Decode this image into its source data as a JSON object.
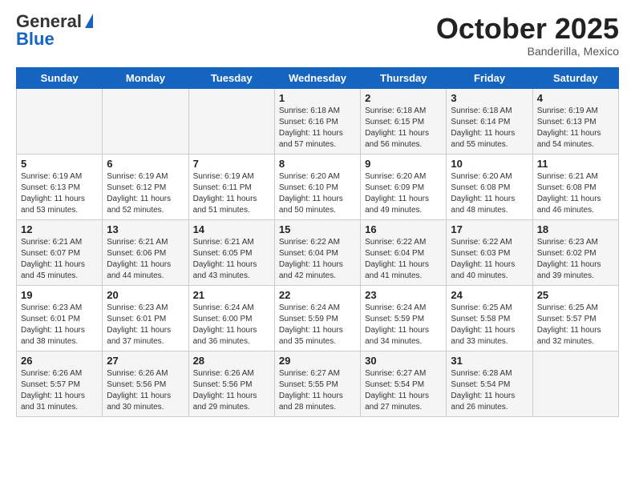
{
  "header": {
    "logo_general": "General",
    "logo_blue": "Blue",
    "month_title": "October 2025",
    "subtitle": "Banderilla, Mexico"
  },
  "days_of_week": [
    "Sunday",
    "Monday",
    "Tuesday",
    "Wednesday",
    "Thursday",
    "Friday",
    "Saturday"
  ],
  "weeks": [
    [
      null,
      null,
      null,
      {
        "day": "1",
        "sunrise": "Sunrise: 6:18 AM",
        "sunset": "Sunset: 6:16 PM",
        "daylight": "Daylight: 11 hours and 57 minutes."
      },
      {
        "day": "2",
        "sunrise": "Sunrise: 6:18 AM",
        "sunset": "Sunset: 6:15 PM",
        "daylight": "Daylight: 11 hours and 56 minutes."
      },
      {
        "day": "3",
        "sunrise": "Sunrise: 6:18 AM",
        "sunset": "Sunset: 6:14 PM",
        "daylight": "Daylight: 11 hours and 55 minutes."
      },
      {
        "day": "4",
        "sunrise": "Sunrise: 6:19 AM",
        "sunset": "Sunset: 6:13 PM",
        "daylight": "Daylight: 11 hours and 54 minutes."
      }
    ],
    [
      {
        "day": "5",
        "sunrise": "Sunrise: 6:19 AM",
        "sunset": "Sunset: 6:13 PM",
        "daylight": "Daylight: 11 hours and 53 minutes."
      },
      {
        "day": "6",
        "sunrise": "Sunrise: 6:19 AM",
        "sunset": "Sunset: 6:12 PM",
        "daylight": "Daylight: 11 hours and 52 minutes."
      },
      {
        "day": "7",
        "sunrise": "Sunrise: 6:19 AM",
        "sunset": "Sunset: 6:11 PM",
        "daylight": "Daylight: 11 hours and 51 minutes."
      },
      {
        "day": "8",
        "sunrise": "Sunrise: 6:20 AM",
        "sunset": "Sunset: 6:10 PM",
        "daylight": "Daylight: 11 hours and 50 minutes."
      },
      {
        "day": "9",
        "sunrise": "Sunrise: 6:20 AM",
        "sunset": "Sunset: 6:09 PM",
        "daylight": "Daylight: 11 hours and 49 minutes."
      },
      {
        "day": "10",
        "sunrise": "Sunrise: 6:20 AM",
        "sunset": "Sunset: 6:08 PM",
        "daylight": "Daylight: 11 hours and 48 minutes."
      },
      {
        "day": "11",
        "sunrise": "Sunrise: 6:21 AM",
        "sunset": "Sunset: 6:08 PM",
        "daylight": "Daylight: 11 hours and 46 minutes."
      }
    ],
    [
      {
        "day": "12",
        "sunrise": "Sunrise: 6:21 AM",
        "sunset": "Sunset: 6:07 PM",
        "daylight": "Daylight: 11 hours and 45 minutes."
      },
      {
        "day": "13",
        "sunrise": "Sunrise: 6:21 AM",
        "sunset": "Sunset: 6:06 PM",
        "daylight": "Daylight: 11 hours and 44 minutes."
      },
      {
        "day": "14",
        "sunrise": "Sunrise: 6:21 AM",
        "sunset": "Sunset: 6:05 PM",
        "daylight": "Daylight: 11 hours and 43 minutes."
      },
      {
        "day": "15",
        "sunrise": "Sunrise: 6:22 AM",
        "sunset": "Sunset: 6:04 PM",
        "daylight": "Daylight: 11 hours and 42 minutes."
      },
      {
        "day": "16",
        "sunrise": "Sunrise: 6:22 AM",
        "sunset": "Sunset: 6:04 PM",
        "daylight": "Daylight: 11 hours and 41 minutes."
      },
      {
        "day": "17",
        "sunrise": "Sunrise: 6:22 AM",
        "sunset": "Sunset: 6:03 PM",
        "daylight": "Daylight: 11 hours and 40 minutes."
      },
      {
        "day": "18",
        "sunrise": "Sunrise: 6:23 AM",
        "sunset": "Sunset: 6:02 PM",
        "daylight": "Daylight: 11 hours and 39 minutes."
      }
    ],
    [
      {
        "day": "19",
        "sunrise": "Sunrise: 6:23 AM",
        "sunset": "Sunset: 6:01 PM",
        "daylight": "Daylight: 11 hours and 38 minutes."
      },
      {
        "day": "20",
        "sunrise": "Sunrise: 6:23 AM",
        "sunset": "Sunset: 6:01 PM",
        "daylight": "Daylight: 11 hours and 37 minutes."
      },
      {
        "day": "21",
        "sunrise": "Sunrise: 6:24 AM",
        "sunset": "Sunset: 6:00 PM",
        "daylight": "Daylight: 11 hours and 36 minutes."
      },
      {
        "day": "22",
        "sunrise": "Sunrise: 6:24 AM",
        "sunset": "Sunset: 5:59 PM",
        "daylight": "Daylight: 11 hours and 35 minutes."
      },
      {
        "day": "23",
        "sunrise": "Sunrise: 6:24 AM",
        "sunset": "Sunset: 5:59 PM",
        "daylight": "Daylight: 11 hours and 34 minutes."
      },
      {
        "day": "24",
        "sunrise": "Sunrise: 6:25 AM",
        "sunset": "Sunset: 5:58 PM",
        "daylight": "Daylight: 11 hours and 33 minutes."
      },
      {
        "day": "25",
        "sunrise": "Sunrise: 6:25 AM",
        "sunset": "Sunset: 5:57 PM",
        "daylight": "Daylight: 11 hours and 32 minutes."
      }
    ],
    [
      {
        "day": "26",
        "sunrise": "Sunrise: 6:26 AM",
        "sunset": "Sunset: 5:57 PM",
        "daylight": "Daylight: 11 hours and 31 minutes."
      },
      {
        "day": "27",
        "sunrise": "Sunrise: 6:26 AM",
        "sunset": "Sunset: 5:56 PM",
        "daylight": "Daylight: 11 hours and 30 minutes."
      },
      {
        "day": "28",
        "sunrise": "Sunrise: 6:26 AM",
        "sunset": "Sunset: 5:56 PM",
        "daylight": "Daylight: 11 hours and 29 minutes."
      },
      {
        "day": "29",
        "sunrise": "Sunrise: 6:27 AM",
        "sunset": "Sunset: 5:55 PM",
        "daylight": "Daylight: 11 hours and 28 minutes."
      },
      {
        "day": "30",
        "sunrise": "Sunrise: 6:27 AM",
        "sunset": "Sunset: 5:54 PM",
        "daylight": "Daylight: 11 hours and 27 minutes."
      },
      {
        "day": "31",
        "sunrise": "Sunrise: 6:28 AM",
        "sunset": "Sunset: 5:54 PM",
        "daylight": "Daylight: 11 hours and 26 minutes."
      },
      null
    ]
  ]
}
